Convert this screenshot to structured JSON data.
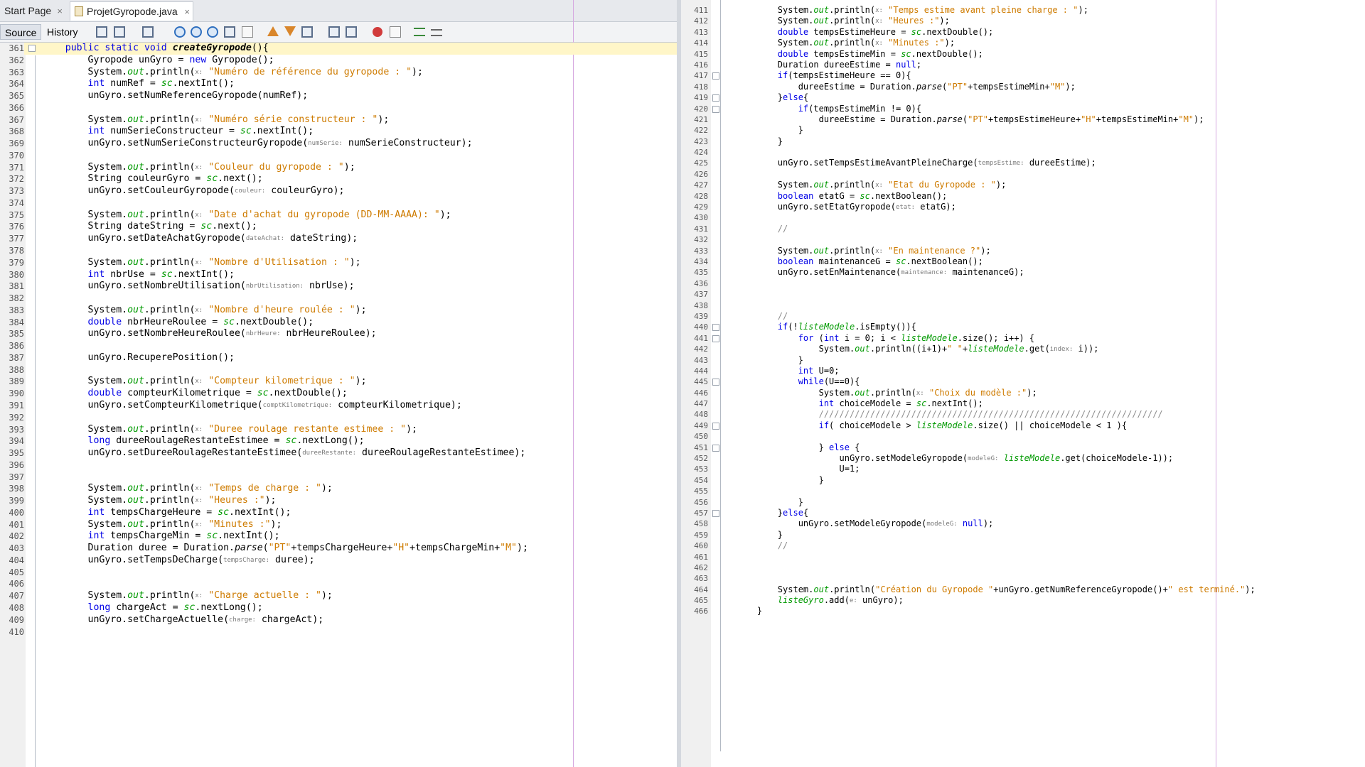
{
  "tabs": {
    "start_page": "Start Page",
    "file": "ProjetGyropode.java",
    "close": "×"
  },
  "toolbar": {
    "source": "Source",
    "history": "History"
  },
  "left_code": [
    {
      "n": "361",
      "t": "    public static void createGyropode(){"
    },
    {
      "n": "362",
      "t": "        Gyropode unGyro = new Gyropode();"
    },
    {
      "n": "363",
      "t": "        System.out.println(x: \"Numéro de référence du gyropode : \");"
    },
    {
      "n": "364",
      "t": "        int numRef = sc.nextInt();"
    },
    {
      "n": "365",
      "t": "        unGyro.setNumReferenceGyropode(numRef);"
    },
    {
      "n": "366",
      "t": ""
    },
    {
      "n": "367",
      "t": "        System.out.println(x: \"Numéro série constructeur : \");"
    },
    {
      "n": "368",
      "t": "        int numSerieConstructeur = sc.nextInt();"
    },
    {
      "n": "369",
      "t": "        unGyro.setNumSerieConstructeurGyropode(numSerie: numSerieConstructeur);"
    },
    {
      "n": "370",
      "t": ""
    },
    {
      "n": "371",
      "t": "        System.out.println(x: \"Couleur du gyropode : \");"
    },
    {
      "n": "372",
      "t": "        String couleurGyro = sc.next();"
    },
    {
      "n": "373",
      "t": "        unGyro.setCouleurGyropode(couleur: couleurGyro);"
    },
    {
      "n": "374",
      "t": ""
    },
    {
      "n": "375",
      "t": "        System.out.println(x: \"Date d'achat du gyropode (DD-MM-AAAA): \");"
    },
    {
      "n": "376",
      "t": "        String dateString = sc.next();"
    },
    {
      "n": "377",
      "t": "        unGyro.setDateAchatGyropode(dateAchat: dateString);"
    },
    {
      "n": "378",
      "t": ""
    },
    {
      "n": "379",
      "t": "        System.out.println(x: \"Nombre d'Utilisation : \");"
    },
    {
      "n": "380",
      "t": "        int nbrUse = sc.nextInt();"
    },
    {
      "n": "381",
      "t": "        unGyro.setNombreUtilisation(nbrUtilisation: nbrUse);"
    },
    {
      "n": "382",
      "t": ""
    },
    {
      "n": "383",
      "t": "        System.out.println(x: \"Nombre d'heure roulée : \");"
    },
    {
      "n": "384",
      "t": "        double nbrHeureRoulee = sc.nextDouble();"
    },
    {
      "n": "385",
      "t": "        unGyro.setNombreHeureRoulee(nbrHeure: nbrHeureRoulee);"
    },
    {
      "n": "386",
      "t": ""
    },
    {
      "n": "387",
      "t": "        unGyro.RecuperePosition();"
    },
    {
      "n": "388",
      "t": ""
    },
    {
      "n": "389",
      "t": "        System.out.println(x: \"Compteur kilometrique : \");"
    },
    {
      "n": "390",
      "t": "        double compteurKilometrique = sc.nextDouble();"
    },
    {
      "n": "391",
      "t": "        unGyro.setCompteurKilometrique(comptKilometrique: compteurKilometrique);"
    },
    {
      "n": "392",
      "t": ""
    },
    {
      "n": "393",
      "t": "        System.out.println(x: \"Duree roulage restante estimee : \");"
    },
    {
      "n": "394",
      "t": "        long dureeRoulageRestanteEstimee = sc.nextLong();"
    },
    {
      "n": "395",
      "t": "        unGyro.setDureeRoulageRestanteEstimee(dureeRestante: dureeRoulageRestanteEstimee);"
    },
    {
      "n": "396",
      "t": ""
    },
    {
      "n": "397",
      "t": ""
    },
    {
      "n": "398",
      "t": "        System.out.println(x: \"Temps de charge : \");"
    },
    {
      "n": "399",
      "t": "        System.out.println(x: \"Heures :\");"
    },
    {
      "n": "400",
      "t": "        int tempsChargeHeure = sc.nextInt();"
    },
    {
      "n": "401",
      "t": "        System.out.println(x: \"Minutes :\");"
    },
    {
      "n": "402",
      "t": "        int tempsChargeMin = sc.nextInt();"
    },
    {
      "n": "403",
      "t": "        Duration duree = Duration.parse(\"PT\"+tempsChargeHeure+\"H\"+tempsChargeMin+\"M\");"
    },
    {
      "n": "404",
      "t": "        unGyro.setTempsDeCharge(tempsCharge: duree);"
    },
    {
      "n": "405",
      "t": ""
    },
    {
      "n": "406",
      "t": ""
    },
    {
      "n": "407",
      "t": "        System.out.println(x: \"Charge actuelle : \");"
    },
    {
      "n": "408",
      "t": "        long chargeAct = sc.nextLong();"
    },
    {
      "n": "409",
      "t": "        unGyro.setChargeActuelle(charge: chargeAct);"
    },
    {
      "n": "410",
      "t": ""
    }
  ],
  "right_code": [
    {
      "n": "411",
      "t": "        System.out.println(x: \"Temps estime avant pleine charge : \");"
    },
    {
      "n": "412",
      "t": "        System.out.println(x: \"Heures :\");"
    },
    {
      "n": "413",
      "t": "        double tempsEstimeHeure = sc.nextDouble();"
    },
    {
      "n": "414",
      "t": "        System.out.println(x: \"Minutes :\");"
    },
    {
      "n": "415",
      "t": "        double tempsEstimeMin = sc.nextDouble();"
    },
    {
      "n": "416",
      "t": "        Duration dureeEstime = null;"
    },
    {
      "n": "417",
      "t": "        if(tempsEstimeHeure == 0){"
    },
    {
      "n": "418",
      "t": "            dureeEstime = Duration.parse(\"PT\"+tempsEstimeMin+\"M\");"
    },
    {
      "n": "419",
      "t": "        }else{"
    },
    {
      "n": "420",
      "t": "            if(tempsEstimeMin != 0){"
    },
    {
      "n": "421",
      "t": "                dureeEstime = Duration.parse(\"PT\"+tempsEstimeHeure+\"H\"+tempsEstimeMin+\"M\");"
    },
    {
      "n": "422",
      "t": "            }"
    },
    {
      "n": "423",
      "t": "        }"
    },
    {
      "n": "424",
      "t": ""
    },
    {
      "n": "425",
      "t": "        unGyro.setTempsEstimeAvantPleineCharge(tempsEstime: dureeEstime);"
    },
    {
      "n": "426",
      "t": ""
    },
    {
      "n": "427",
      "t": "        System.out.println(x: \"Etat du Gyropode : \");"
    },
    {
      "n": "428",
      "t": "        boolean etatG = sc.nextBoolean();"
    },
    {
      "n": "429",
      "t": "        unGyro.setEtatGyropode(etat: etatG);"
    },
    {
      "n": "430",
      "t": ""
    },
    {
      "n": "431",
      "t": "        //"
    },
    {
      "n": "432",
      "t": ""
    },
    {
      "n": "433",
      "t": "        System.out.println(x: \"En maintenance ?\");"
    },
    {
      "n": "434",
      "t": "        boolean maintenanceG = sc.nextBoolean();"
    },
    {
      "n": "435",
      "t": "        unGyro.setEnMaintenance(maintenance: maintenanceG);"
    },
    {
      "n": "436",
      "t": ""
    },
    {
      "n": "437",
      "t": ""
    },
    {
      "n": "438",
      "t": ""
    },
    {
      "n": "439",
      "t": "        //"
    },
    {
      "n": "440",
      "t": "        if(!listeModele.isEmpty()){"
    },
    {
      "n": "441",
      "t": "            for (int i = 0; i < listeModele.size(); i++) {"
    },
    {
      "n": "442",
      "t": "                System.out.println((i+1)+\" \"+listeModele.get(index: i));"
    },
    {
      "n": "443",
      "t": "            }"
    },
    {
      "n": "444",
      "t": "            int U=0;"
    },
    {
      "n": "445",
      "t": "            while(U==0){"
    },
    {
      "n": "446",
      "t": "                System.out.println(x: \"Choix du modèle :\");"
    },
    {
      "n": "447",
      "t": "                int choiceModele = sc.nextInt();"
    },
    {
      "n": "448",
      "t": "                ///////////////////////////////////////////////////////////////////"
    },
    {
      "n": "449",
      "t": "                if( choiceModele > listeModele.size() || choiceModele < 1 ){"
    },
    {
      "n": "450",
      "t": ""
    },
    {
      "n": "451",
      "t": "                } else {"
    },
    {
      "n": "452",
      "t": "                    unGyro.setModeleGyropode(modeleG: listeModele.get(choiceModele-1));"
    },
    {
      "n": "453",
      "t": "                    U=1;"
    },
    {
      "n": "454",
      "t": "                }"
    },
    {
      "n": "455",
      "t": ""
    },
    {
      "n": "456",
      "t": "            }"
    },
    {
      "n": "457",
      "t": "        }else{"
    },
    {
      "n": "458",
      "t": "            unGyro.setModeleGyropode(modeleG: null);"
    },
    {
      "n": "459",
      "t": "        }"
    },
    {
      "n": "460",
      "t": "        //"
    },
    {
      "n": "461",
      "t": ""
    },
    {
      "n": "462",
      "t": ""
    },
    {
      "n": "463",
      "t": ""
    },
    {
      "n": "464",
      "t": "        System.out.println(\"Création du Gyropode \"+unGyro.getNumReferenceGyropode()+\" est terminé.\");"
    },
    {
      "n": "465",
      "t": "        listeGyro.add(e: unGyro);"
    },
    {
      "n": "466",
      "t": "    }"
    }
  ]
}
